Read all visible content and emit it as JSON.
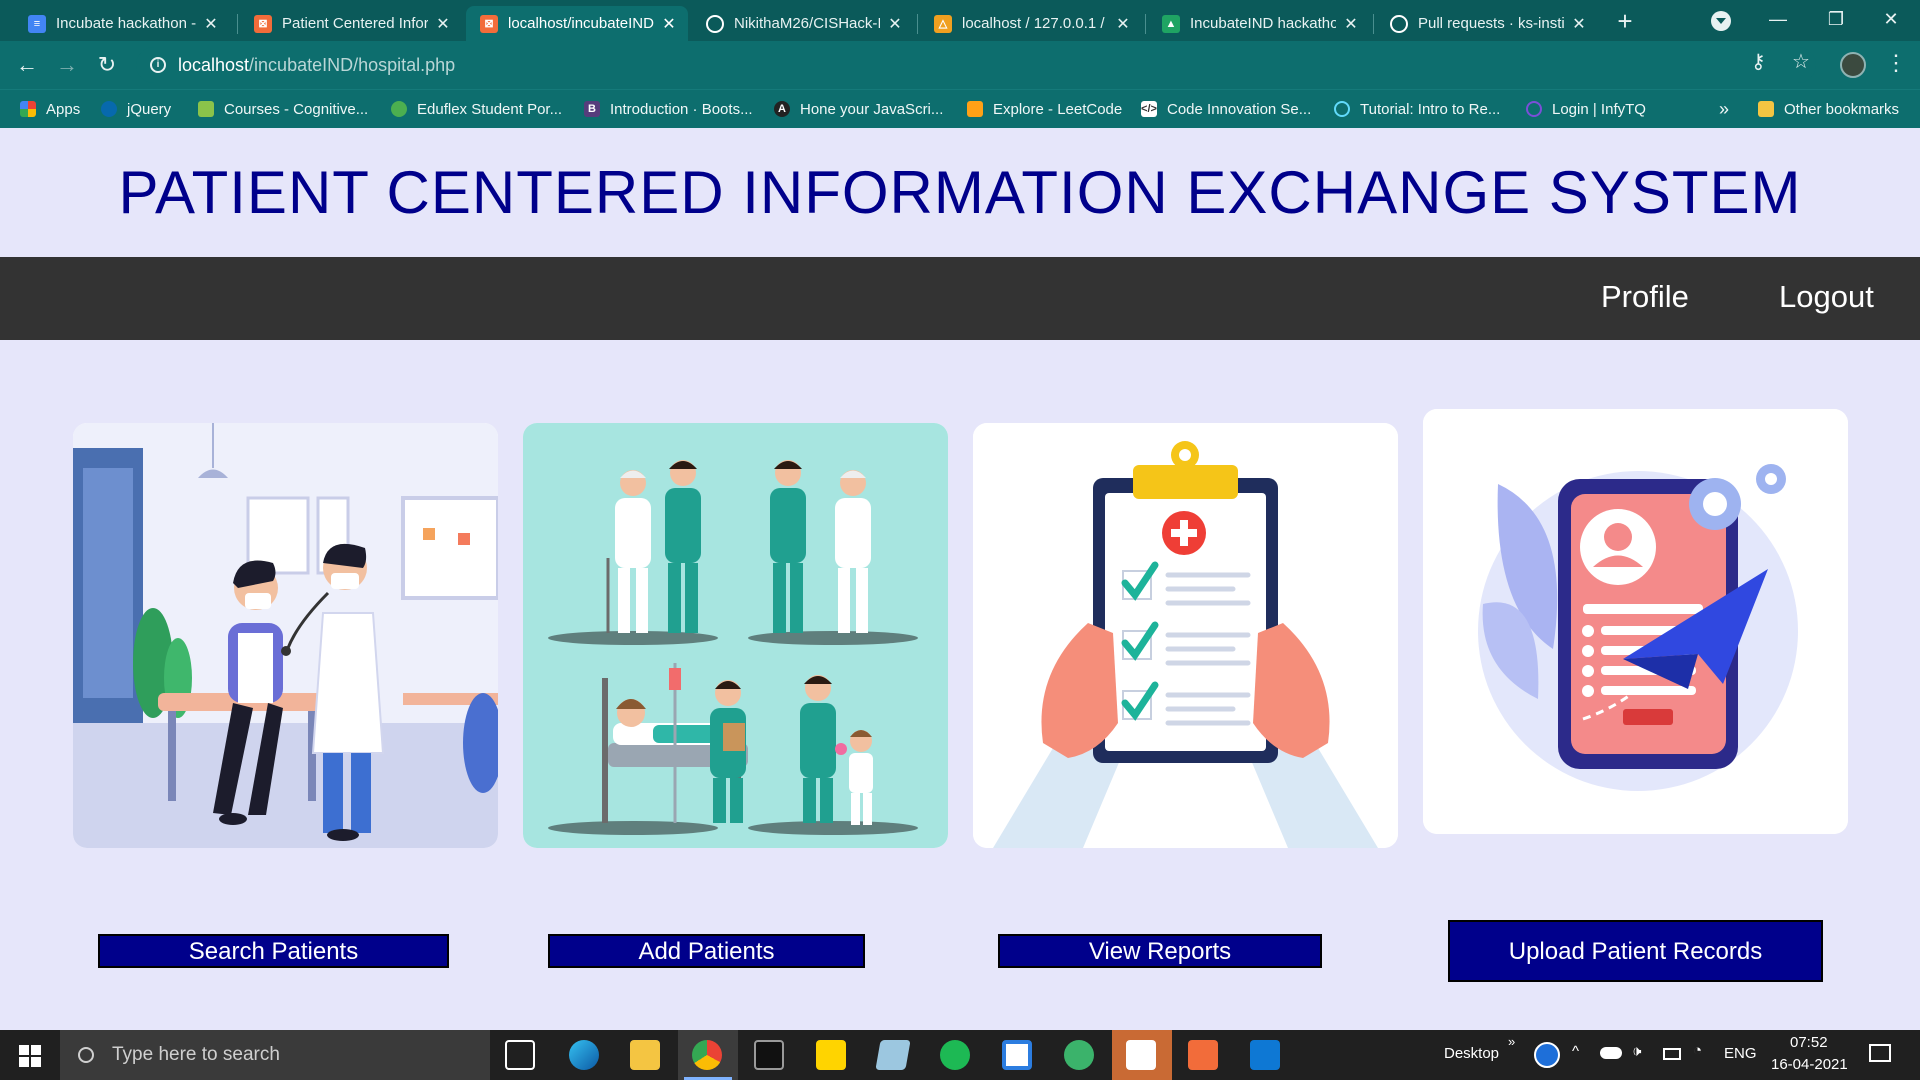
{
  "browser": {
    "tabs": [
      {
        "label": "Incubate hackathon - G",
        "favicon_color": "#4285f4",
        "glyph": "≡"
      },
      {
        "label": "Patient Centered Infor",
        "favicon_color": "#f26c3a",
        "glyph": "⊠"
      },
      {
        "label": "localhost/incubateIND",
        "favicon_color": "#f26c3a",
        "glyph": "⊠",
        "active": true
      },
      {
        "label": "NikithaM26/CISHack-I",
        "favicon_color": "#ffffff",
        "glyph": "●"
      },
      {
        "label": "localhost / 127.0.0.1 /",
        "favicon_color": "#f0a020",
        "glyph": "⛵"
      },
      {
        "label": "IncubateIND hackatho",
        "favicon_color": "#1fa463",
        "glyph": "▲"
      },
      {
        "label": "Pull requests · ks-instit",
        "favicon_color": "#ffffff",
        "glyph": "●"
      }
    ],
    "url_host": "localhost",
    "url_path": "/incubateIND/hospital.php",
    "bookmarks": [
      {
        "label": "Apps",
        "icon_color": "#ea4335"
      },
      {
        "label": "jQuery",
        "icon_color": "#0769ad"
      },
      {
        "label": "Courses - Cognitive...",
        "icon_color": "#8bc34a"
      },
      {
        "label": "Eduflex Student Por...",
        "icon_color": "#4caf50"
      },
      {
        "label": "Introduction · Boots...",
        "icon_color": "#563d7c"
      },
      {
        "label": "Hone your JavaScri...",
        "icon_color": "#222222"
      },
      {
        "label": "Explore - LeetCode",
        "icon_color": "#ffa116"
      },
      {
        "label": "Code Innovation Se...",
        "icon_color": "#ffffff"
      },
      {
        "label": "Tutorial: Intro to Re...",
        "icon_color": "#61dafb"
      },
      {
        "label": "Login | InfyTQ",
        "icon_color": "#7b4fd8"
      }
    ],
    "bookmarks_overflow": "»",
    "other_bookmarks": "Other bookmarks"
  },
  "page": {
    "title": "PATIENT CENTERED INFORMATION EXCHANGE SYSTEM",
    "nav": {
      "profile": "Profile",
      "logout": "Logout"
    },
    "cards": [
      {
        "button": "Search Patients",
        "image": "doctor-examining-patient"
      },
      {
        "button": "Add Patients",
        "image": "doctors-and-patients-group"
      },
      {
        "button": "View Reports",
        "image": "clipboard-checklist"
      },
      {
        "button": "Upload Patient Records",
        "image": "phone-profile-paper-plane"
      }
    ]
  },
  "taskbar": {
    "search_placeholder": "Type here to search",
    "desktop_label": "Desktop",
    "tray_overflow": "»",
    "language": "ENG",
    "time": "07:52",
    "date": "16-04-2021"
  },
  "colors": {
    "page_bg": "#e6e6fa",
    "title_color": "#00008b",
    "navbar_bg": "#333333",
    "button_bg": "#00008b",
    "chrome_teal": "#0d6e6e"
  }
}
